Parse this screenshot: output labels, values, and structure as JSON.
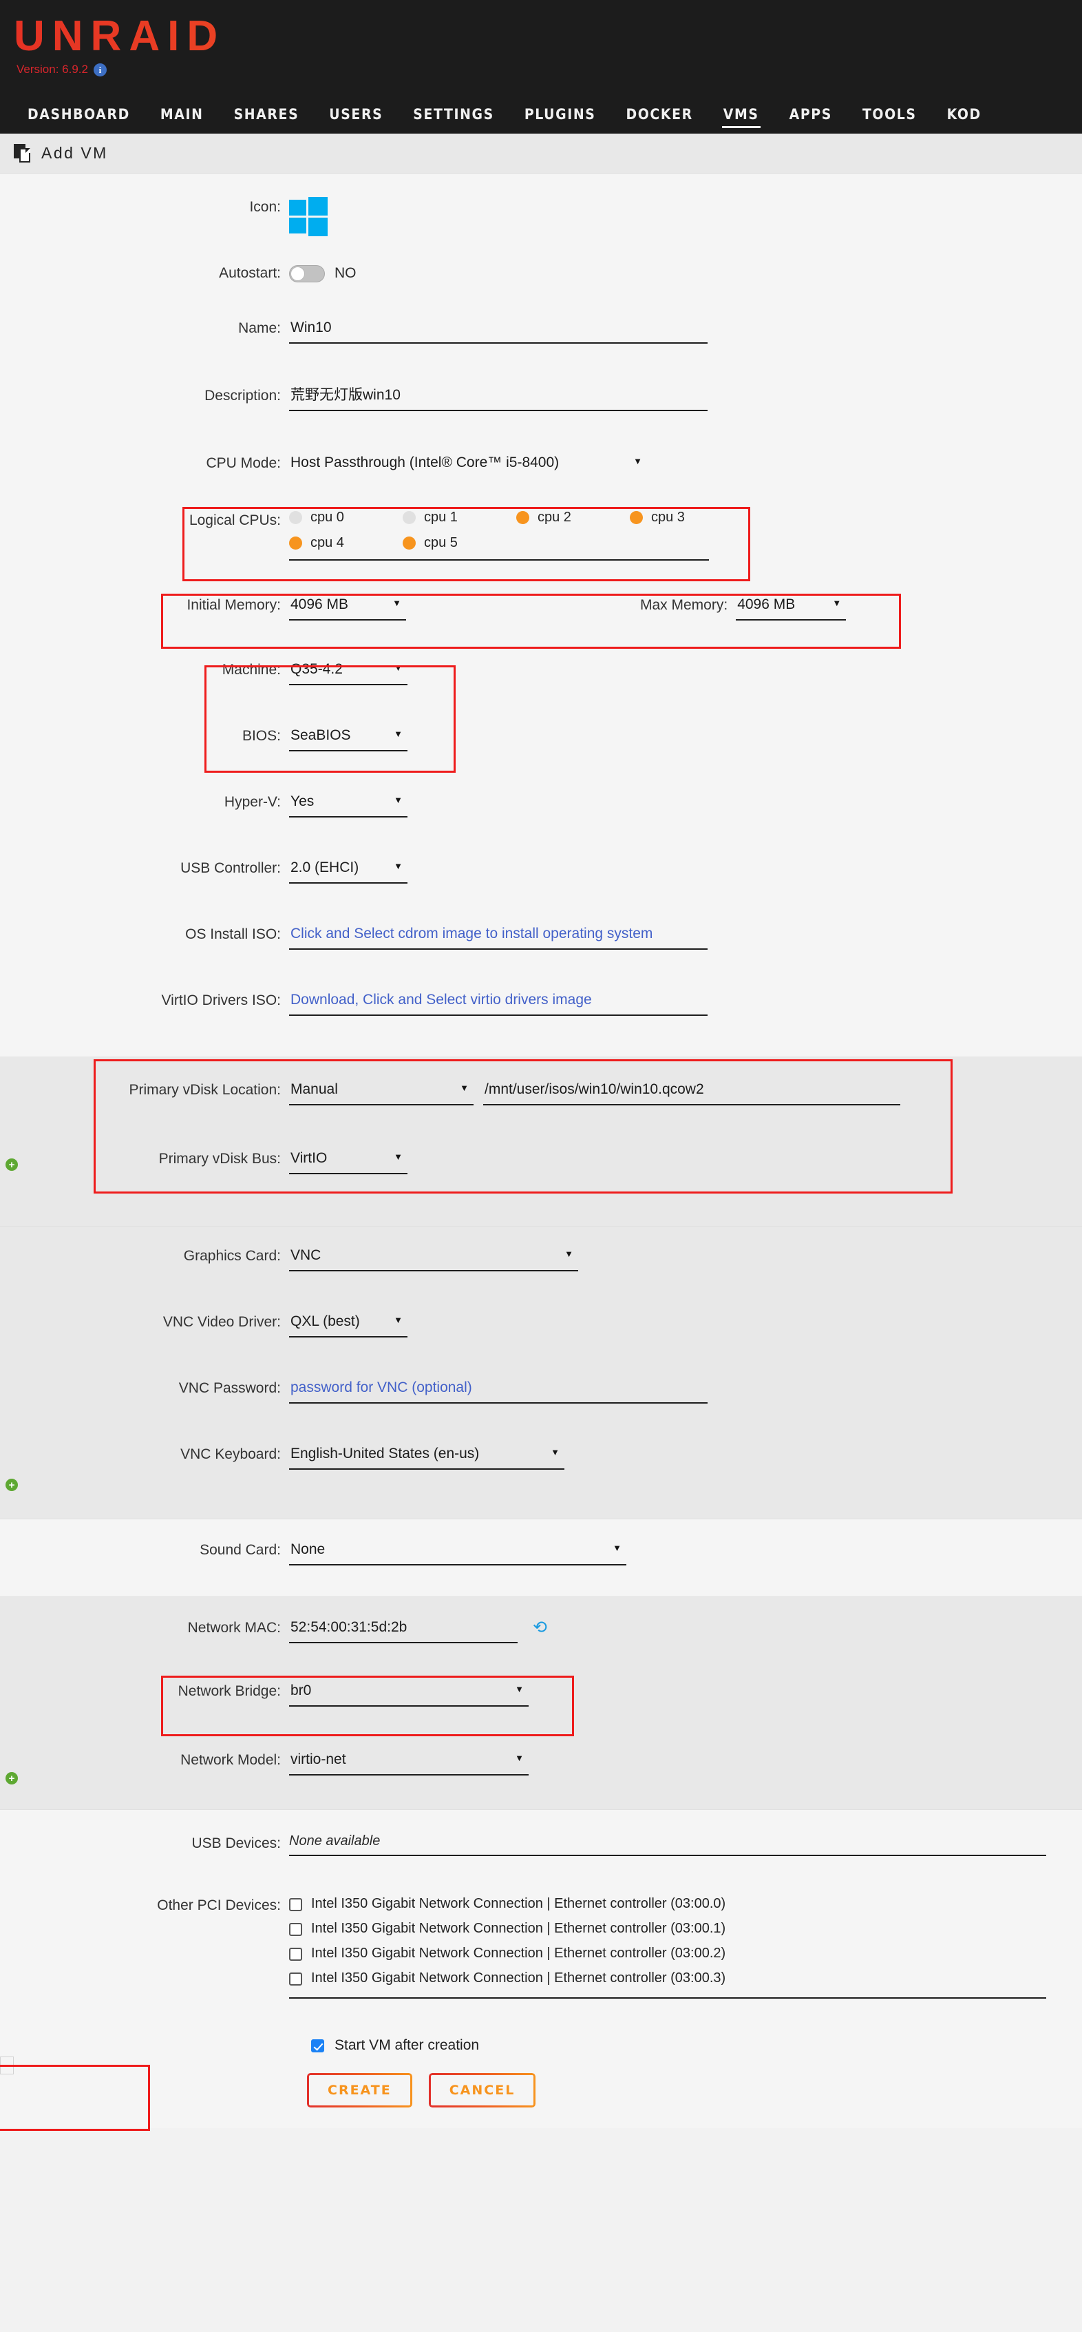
{
  "header": {
    "brand": "UNRAID",
    "version": "Version: 6.9.2",
    "info_icon": "info-icon",
    "nav": [
      {
        "label": "DASHBOARD",
        "active": false
      },
      {
        "label": "MAIN",
        "active": false
      },
      {
        "label": "SHARES",
        "active": false
      },
      {
        "label": "USERS",
        "active": false
      },
      {
        "label": "SETTINGS",
        "active": false
      },
      {
        "label": "PLUGINS",
        "active": false
      },
      {
        "label": "DOCKER",
        "active": false
      },
      {
        "label": "VMS",
        "active": true
      },
      {
        "label": "APPS",
        "active": false
      },
      {
        "label": "TOOLS",
        "active": false
      },
      {
        "label": "KOD",
        "active": false
      }
    ]
  },
  "page": {
    "title": "Add VM",
    "icon": "pages-icon"
  },
  "form": {
    "icon": {
      "label": "Icon:",
      "value": "windows-logo"
    },
    "autostart": {
      "label": "Autostart:",
      "state": "NO",
      "on": false
    },
    "name": {
      "label": "Name:",
      "value": "Win10"
    },
    "description": {
      "label": "Description:",
      "value": "荒野无灯版win10"
    },
    "cpu_mode": {
      "label": "CPU Mode:",
      "value": "Host Passthrough (Intel® Core™ i5-8400)"
    },
    "logical_cpus": {
      "label": "Logical CPUs:",
      "items": [
        {
          "label": "cpu 0",
          "checked": false
        },
        {
          "label": "cpu 1",
          "checked": false
        },
        {
          "label": "cpu 2",
          "checked": true
        },
        {
          "label": "cpu 3",
          "checked": true
        },
        {
          "label": "cpu 4",
          "checked": true
        },
        {
          "label": "cpu 5",
          "checked": true
        }
      ]
    },
    "initial_memory": {
      "label": "Initial Memory:",
      "value": "4096 MB"
    },
    "max_memory": {
      "label": "Max Memory:",
      "value": "4096 MB"
    },
    "machine": {
      "label": "Machine:",
      "value": "Q35-4.2"
    },
    "bios": {
      "label": "BIOS:",
      "value": "SeaBIOS"
    },
    "hyperv": {
      "label": "Hyper-V:",
      "value": "Yes"
    },
    "usb_controller": {
      "label": "USB Controller:",
      "value": "2.0 (EHCI)"
    },
    "os_install_iso": {
      "label": "OS Install ISO:",
      "placeholder": "Click and Select cdrom image to install operating system"
    },
    "virtio_iso": {
      "label": "VirtIO Drivers ISO:",
      "placeholder": "Download, Click and Select virtio drivers image"
    },
    "vdisk_location": {
      "label": "Primary vDisk Location:",
      "value": "Manual",
      "path": "/mnt/user/isos/win10/win10.qcow2"
    },
    "vdisk_bus": {
      "label": "Primary vDisk Bus:",
      "value": "VirtIO"
    },
    "graphics_card": {
      "label": "Graphics Card:",
      "value": "VNC"
    },
    "vnc_video_driver": {
      "label": "VNC Video Driver:",
      "value": "QXL (best)"
    },
    "vnc_password": {
      "label": "VNC Password:",
      "placeholder": "password for VNC (optional)"
    },
    "vnc_keyboard": {
      "label": "VNC Keyboard:",
      "value": "English-United States (en-us)"
    },
    "sound_card": {
      "label": "Sound Card:",
      "value": "None"
    },
    "network_mac": {
      "label": "Network MAC:",
      "value": "52:54:00:31:5d:2b",
      "refresh_icon": "refresh-icon"
    },
    "network_bridge": {
      "label": "Network Bridge:",
      "value": "br0"
    },
    "network_model": {
      "label": "Network Model:",
      "value": "virtio-net"
    },
    "usb_devices": {
      "label": "USB Devices:",
      "value": "None available"
    },
    "other_pci": {
      "label": "Other PCI Devices:",
      "items": [
        {
          "label": "Intel I350 Gigabit Network Connection | Ethernet controller (03:00.0)",
          "checked": false
        },
        {
          "label": "Intel I350 Gigabit Network Connection | Ethernet controller (03:00.1)",
          "checked": false
        },
        {
          "label": "Intel I350 Gigabit Network Connection | Ethernet controller (03:00.2)",
          "checked": false
        },
        {
          "label": "Intel I350 Gigabit Network Connection | Ethernet controller (03:00.3)",
          "checked": false
        }
      ]
    },
    "start_after_create": {
      "label": "Start VM after creation",
      "checked": true
    },
    "create_button": "CREATE",
    "cancel_button": "CANCEL",
    "add_marker": "+"
  },
  "colors": {
    "accent_orange": "#f7941e",
    "accent_red": "#e2302b",
    "link_blue": "#4361c9",
    "highlight_red": "#ee1c1c",
    "windows_blue": "#00ADEF",
    "green_plus": "#5ea832"
  }
}
